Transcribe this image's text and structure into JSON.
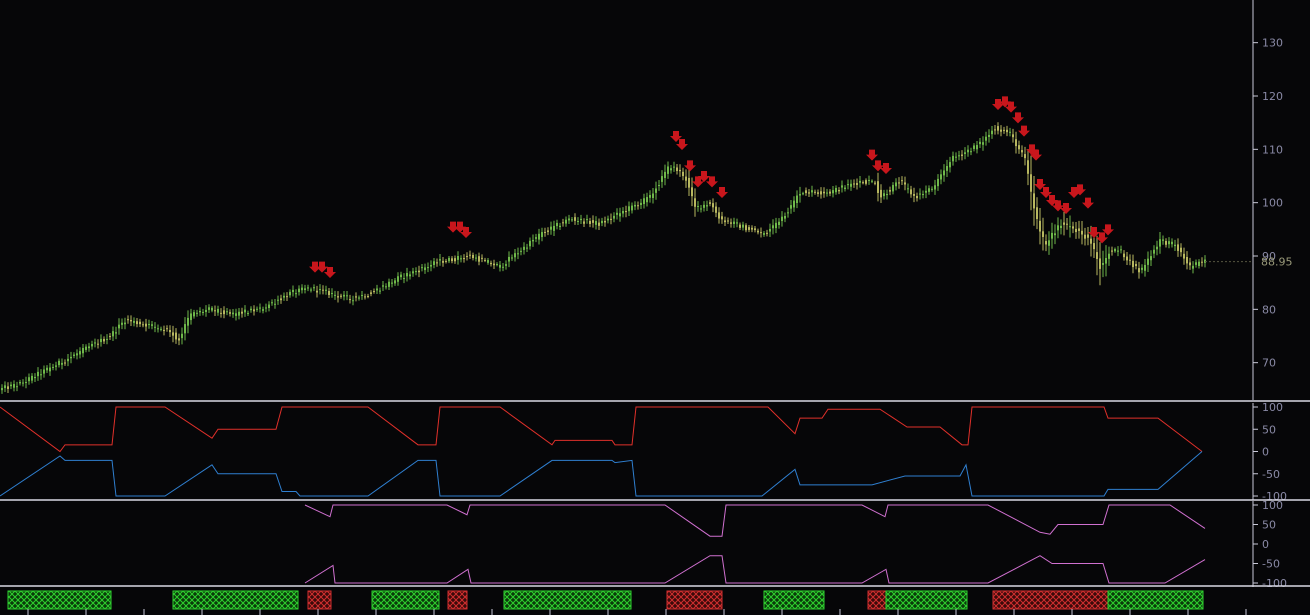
{
  "colors": {
    "background": "#060608",
    "axis": "#c8c8d8",
    "tick_text": "#8a8aa6",
    "separator": "#d8d8e4",
    "bar_up": "#6fb84a",
    "bar_down": "#b8b860",
    "marker": "#c8161c",
    "last_label": "#9a9a7a",
    "aroon_up": "#e0302a",
    "aroon_down": "#2f7fd0",
    "osc_line": "#d070d0",
    "band_green": "#2fd02f",
    "band_red": "#d02f2f"
  },
  "chart_data": [
    {
      "type": "candlestick",
      "name": "price",
      "yticks": [
        70,
        80,
        90,
        100,
        110,
        120,
        130
      ],
      "ylim": [
        63,
        138
      ],
      "last_value_label": "88.95",
      "control_points": [
        [
          0,
          65
        ],
        [
          20,
          66
        ],
        [
          50,
          69
        ],
        [
          80,
          72
        ],
        [
          110,
          75
        ],
        [
          125,
          78
        ],
        [
          150,
          77
        ],
        [
          170,
          76
        ],
        [
          178,
          74
        ],
        [
          190,
          79
        ],
        [
          210,
          80
        ],
        [
          230,
          79
        ],
        [
          260,
          80
        ],
        [
          290,
          83
        ],
        [
          310,
          84
        ],
        [
          330,
          83
        ],
        [
          350,
          82
        ],
        [
          370,
          83
        ],
        [
          400,
          86
        ],
        [
          440,
          89
        ],
        [
          470,
          90
        ],
        [
          500,
          88
        ],
        [
          520,
          91
        ],
        [
          540,
          94
        ],
        [
          570,
          97
        ],
        [
          600,
          96
        ],
        [
          630,
          99
        ],
        [
          650,
          101
        ],
        [
          670,
          107
        ],
        [
          685,
          105
        ],
        [
          695,
          99
        ],
        [
          710,
          100
        ],
        [
          720,
          97
        ],
        [
          750,
          95
        ],
        [
          765,
          94
        ],
        [
          790,
          99
        ],
        [
          800,
          102
        ],
        [
          830,
          102
        ],
        [
          860,
          104
        ],
        [
          875,
          104
        ],
        [
          880,
          101
        ],
        [
          900,
          104
        ],
        [
          915,
          101
        ],
        [
          935,
          103
        ],
        [
          950,
          108
        ],
        [
          980,
          111
        ],
        [
          995,
          114
        ],
        [
          1010,
          113
        ],
        [
          1025,
          108
        ],
        [
          1035,
          98
        ],
        [
          1045,
          92
        ],
        [
          1060,
          96
        ],
        [
          1075,
          95
        ],
        [
          1090,
          93
        ],
        [
          1100,
          88
        ],
        [
          1110,
          91
        ],
        [
          1120,
          91
        ],
        [
          1140,
          87
        ],
        [
          1160,
          93
        ],
        [
          1175,
          92
        ],
        [
          1190,
          88
        ],
        [
          1205,
          89
        ]
      ],
      "markers": [
        [
          315,
          88
        ],
        [
          322,
          88
        ],
        [
          330,
          87
        ],
        [
          453,
          95.5
        ],
        [
          460,
          95.5
        ],
        [
          466,
          94.5
        ],
        [
          676,
          112.5
        ],
        [
          682,
          111
        ],
        [
          690,
          107
        ],
        [
          698,
          104
        ],
        [
          704,
          105
        ],
        [
          712,
          104
        ],
        [
          722,
          102
        ],
        [
          872,
          109
        ],
        [
          878,
          107
        ],
        [
          886,
          106.5
        ],
        [
          998,
          118.5
        ],
        [
          1005,
          119
        ],
        [
          1011,
          118
        ],
        [
          1018,
          116
        ],
        [
          1024,
          113.5
        ],
        [
          1032,
          110
        ],
        [
          1036,
          109
        ],
        [
          1040,
          103.5
        ],
        [
          1046,
          102
        ],
        [
          1052,
          100.5
        ],
        [
          1058,
          99.5
        ],
        [
          1066,
          99
        ],
        [
          1074,
          102
        ],
        [
          1080,
          102.5
        ],
        [
          1088,
          100
        ],
        [
          1094,
          94.5
        ],
        [
          1102,
          93.5
        ],
        [
          1108,
          95
        ]
      ]
    },
    {
      "type": "line",
      "name": "aroon",
      "yticks": [
        100,
        50,
        0,
        -50,
        -100
      ],
      "ylim": [
        -100,
        100
      ],
      "series": [
        {
          "color_key": "aroon_up",
          "points": [
            [
              0,
              100
            ],
            [
              60,
              0
            ],
            [
              65,
              15
            ],
            [
              112,
              15
            ],
            [
              116,
              100
            ],
            [
              165,
              100
            ],
            [
              212,
              30
            ],
            [
              218,
              50
            ],
            [
              276,
              50
            ],
            [
              282,
              100
            ],
            [
              368,
              100
            ],
            [
              418,
              15
            ],
            [
              436,
              15
            ],
            [
              440,
              100
            ],
            [
              500,
              100
            ],
            [
              552,
              15
            ],
            [
              555,
              25
            ],
            [
              612,
              25
            ],
            [
              615,
              15
            ],
            [
              632,
              15
            ],
            [
              636,
              100
            ],
            [
              768,
              100
            ],
            [
              795,
              40
            ],
            [
              800,
              75
            ],
            [
              822,
              75
            ],
            [
              828,
              95
            ],
            [
              880,
              95
            ],
            [
              907,
              55
            ],
            [
              940,
              55
            ],
            [
              962,
              15
            ],
            [
              968,
              15
            ],
            [
              972,
              100
            ],
            [
              1104,
              100
            ],
            [
              1108,
              75
            ],
            [
              1158,
              75
            ],
            [
              1202,
              0
            ]
          ]
        },
        {
          "color_key": "aroon_down",
          "points": [
            [
              0,
              -100
            ],
            [
              60,
              -10
            ],
            [
              65,
              -20
            ],
            [
              112,
              -20
            ],
            [
              116,
              -100
            ],
            [
              165,
              -100
            ],
            [
              212,
              -30
            ],
            [
              218,
              -50
            ],
            [
              276,
              -50
            ],
            [
              282,
              -90
            ],
            [
              296,
              -90
            ],
            [
              300,
              -100
            ],
            [
              368,
              -100
            ],
            [
              418,
              -20
            ],
            [
              436,
              -20
            ],
            [
              440,
              -100
            ],
            [
              500,
              -100
            ],
            [
              552,
              -20
            ],
            [
              612,
              -20
            ],
            [
              615,
              -25
            ],
            [
              632,
              -20
            ],
            [
              636,
              -100
            ],
            [
              762,
              -100
            ],
            [
              795,
              -40
            ],
            [
              800,
              -75
            ],
            [
              872,
              -75
            ],
            [
              905,
              -55
            ],
            [
              960,
              -55
            ],
            [
              966,
              -30
            ],
            [
              972,
              -100
            ],
            [
              1104,
              -100
            ],
            [
              1108,
              -85
            ],
            [
              1158,
              -85
            ],
            [
              1202,
              0
            ]
          ]
        }
      ]
    },
    {
      "type": "line",
      "name": "oscillator",
      "yticks": [
        100,
        50,
        0,
        -50,
        -100
      ],
      "ylim": [
        -100,
        100
      ],
      "series": [
        {
          "color_key": "osc_line",
          "points": [
            [
              305,
              100
            ],
            [
              330,
              70
            ],
            [
              333,
              100
            ],
            [
              360,
              100
            ],
            [
              447,
              100
            ],
            [
              467,
              75
            ],
            [
              470,
              100
            ],
            [
              500,
              100
            ],
            [
              665,
              100
            ],
            [
              710,
              20
            ],
            [
              722,
              20
            ],
            [
              726,
              100
            ],
            [
              760,
              100
            ],
            [
              862,
              100
            ],
            [
              885,
              70
            ],
            [
              888,
              100
            ],
            [
              920,
              100
            ],
            [
              988,
              100
            ],
            [
              1040,
              30
            ],
            [
              1050,
              25
            ],
            [
              1058,
              50
            ],
            [
              1103,
              50
            ],
            [
              1109,
              100
            ],
            [
              1170,
              100
            ],
            [
              1205,
              40
            ]
          ]
        },
        {
          "color_key": "osc_line",
          "points": [
            [
              305,
              -100
            ],
            [
              333,
              -55
            ],
            [
              335,
              -100
            ],
            [
              447,
              -100
            ],
            [
              468,
              -65
            ],
            [
              471,
              -100
            ],
            [
              665,
              -100
            ],
            [
              710,
              -30
            ],
            [
              722,
              -30
            ],
            [
              726,
              -100
            ],
            [
              862,
              -100
            ],
            [
              886,
              -65
            ],
            [
              889,
              -100
            ],
            [
              988,
              -100
            ],
            [
              1040,
              -30
            ],
            [
              1052,
              -50
            ],
            [
              1103,
              -50
            ],
            [
              1109,
              -100
            ],
            [
              1165,
              -100
            ],
            [
              1205,
              -40
            ]
          ]
        }
      ]
    },
    {
      "type": "bands",
      "name": "state",
      "segments": [
        {
          "start": 8,
          "end": 111,
          "state": "green"
        },
        {
          "start": 173,
          "end": 298,
          "state": "green"
        },
        {
          "start": 308,
          "end": 331,
          "state": "red"
        },
        {
          "start": 372,
          "end": 439,
          "state": "green"
        },
        {
          "start": 448,
          "end": 467,
          "state": "red"
        },
        {
          "start": 504,
          "end": 631,
          "state": "green"
        },
        {
          "start": 667,
          "end": 722,
          "state": "red"
        },
        {
          "start": 764,
          "end": 824,
          "state": "green"
        },
        {
          "start": 868,
          "end": 886,
          "state": "red"
        },
        {
          "start": 886,
          "end": 967,
          "state": "green"
        },
        {
          "start": 993,
          "end": 1108,
          "state": "red"
        },
        {
          "start": 1108,
          "end": 1203,
          "state": "green"
        }
      ]
    }
  ]
}
